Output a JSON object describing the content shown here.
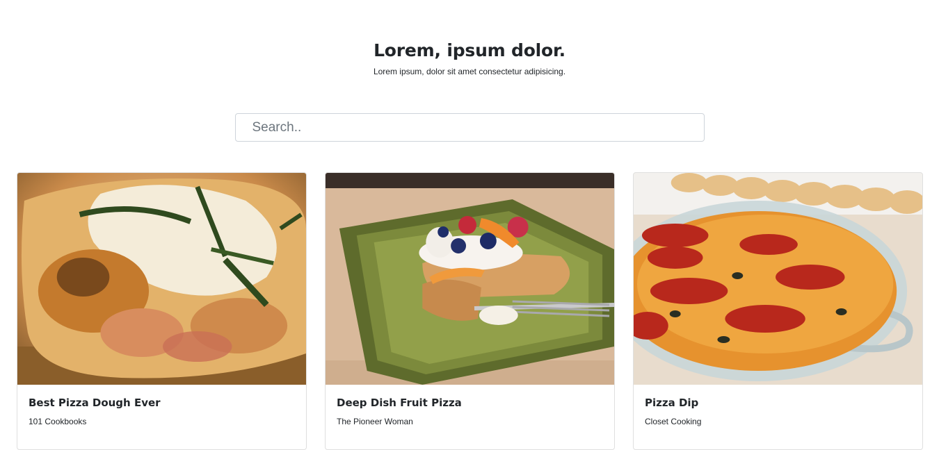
{
  "hero": {
    "title": "Lorem, ipsum dolor.",
    "subtitle": "Lorem ipsum, dolor sit amet consectetur adipisicing."
  },
  "search": {
    "placeholder": "Search..",
    "value": ""
  },
  "cards": [
    {
      "title": "Best Pizza Dough Ever",
      "publisher": "101 Cookbooks"
    },
    {
      "title": "Deep Dish Fruit Pizza",
      "publisher": "The Pioneer Woman"
    },
    {
      "title": "Pizza Dip",
      "publisher": "Closet Cooking"
    }
  ]
}
